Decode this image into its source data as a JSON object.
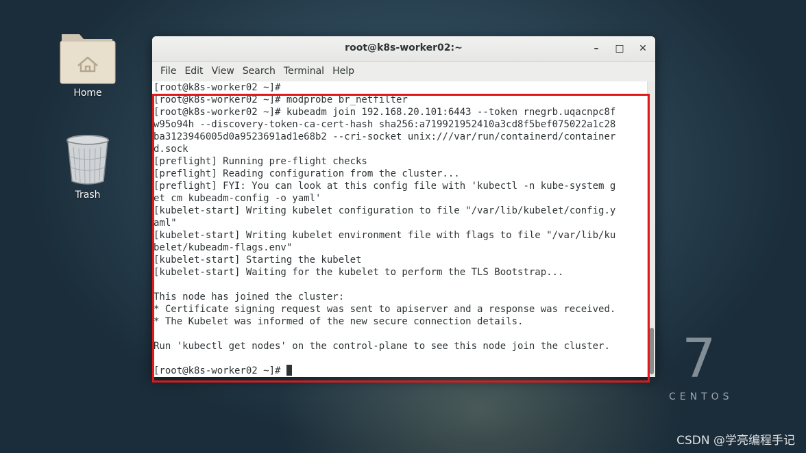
{
  "desktop": {
    "icons": [
      {
        "label": "Home",
        "icon": "home-folder-icon"
      },
      {
        "label": "Trash",
        "icon": "trash-icon"
      }
    ],
    "branding": {
      "version": "7",
      "name": "CENTOS"
    },
    "watermark": "CSDN @学亮编程手记"
  },
  "window": {
    "title": "root@k8s-worker02:~",
    "controls": {
      "minimize": "–",
      "maximize": "□",
      "close": "✕"
    },
    "menu": [
      "File",
      "Edit",
      "View",
      "Search",
      "Terminal",
      "Help"
    ]
  },
  "terminal": {
    "lines": [
      "[root@k8s-worker02 ~]#",
      "[root@k8s-worker02 ~]# modprobe br_netfilter",
      "[root@k8s-worker02 ~]# kubeadm join 192.168.20.101:6443 --token rnegrb.uqacnpc8f",
      "w95o94h --discovery-token-ca-cert-hash sha256:a719921952410a3cd8f5bef075022a1c28",
      "ba3123946005d0a9523691ad1e68b2 --cri-socket unix:///var/run/containerd/container",
      "d.sock",
      "[preflight] Running pre-flight checks",
      "[preflight] Reading configuration from the cluster...",
      "[preflight] FYI: You can look at this config file with 'kubectl -n kube-system g",
      "et cm kubeadm-config -o yaml'",
      "[kubelet-start] Writing kubelet configuration to file \"/var/lib/kubelet/config.y",
      "aml\"",
      "[kubelet-start] Writing kubelet environment file with flags to file \"/var/lib/ku",
      "belet/kubeadm-flags.env\"",
      "[kubelet-start] Starting the kubelet",
      "[kubelet-start] Waiting for the kubelet to perform the TLS Bootstrap...",
      "",
      "This node has joined the cluster:",
      "* Certificate signing request was sent to apiserver and a response was received.",
      "* The Kubelet was informed of the new secure connection details.",
      "",
      "Run 'kubectl get nodes' on the control-plane to see this node join the cluster.",
      "",
      "[root@k8s-worker02 ~]# "
    ]
  },
  "colors": {
    "highlight": "#e0191a",
    "terminal_fg": "#2e3436",
    "terminal_bg": "#ffffff"
  }
}
